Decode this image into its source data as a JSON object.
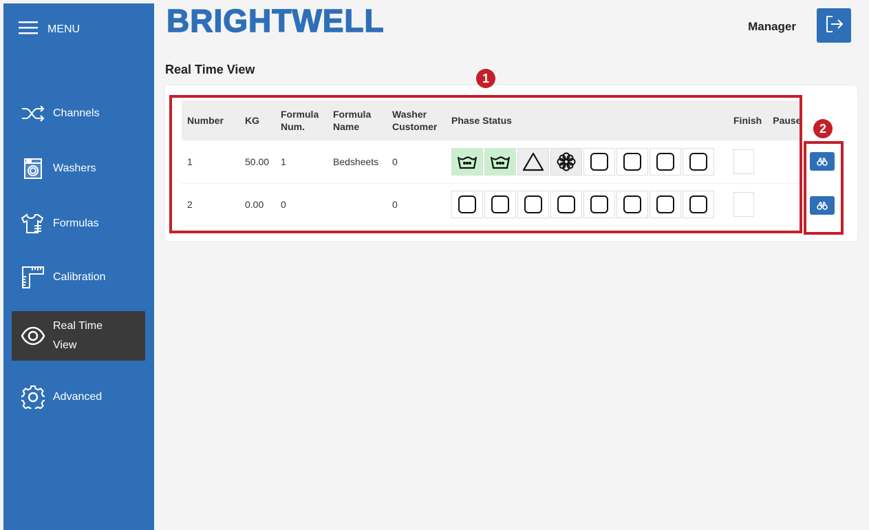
{
  "sidebar": {
    "menu_label": "MENU",
    "items": [
      {
        "label": "Channels",
        "icon": "shuffle-icon"
      },
      {
        "label": "Washers",
        "icon": "washer-icon"
      },
      {
        "label": "Formulas",
        "icon": "shirt-icon"
      },
      {
        "label": "Calibration",
        "icon": "ruler-icon"
      },
      {
        "label_line1": "Real Time",
        "label_line2": "View",
        "icon": "eye-icon",
        "active": true
      },
      {
        "label": "Advanced",
        "icon": "gear-icon"
      }
    ]
  },
  "header": {
    "logo": "BRIGHTWELL",
    "user": "Manager"
  },
  "page": {
    "title": "Real Time View"
  },
  "annotations": {
    "badge1": "1",
    "badge2": "2"
  },
  "table": {
    "headers": {
      "number": "Number",
      "kg": "KG",
      "formula_num_1": "Formula",
      "formula_num_2": "Num.",
      "formula_name_1": "Formula",
      "formula_name_2": "Name",
      "washer_customer_1": "Washer",
      "washer_customer_2": "Customer",
      "phase_status": "Phase Status",
      "finish": "Finish",
      "pause": "Pause"
    },
    "rows": [
      {
        "number": "1",
        "kg": "50.00",
        "formula_num": "1",
        "formula_name": "Bedsheets",
        "washer_customer": "0",
        "phases": [
          "wash-done",
          "wash-done",
          "bleach-current",
          "softener-current",
          "empty",
          "empty",
          "empty",
          "empty"
        ]
      },
      {
        "number": "2",
        "kg": "0.00",
        "formula_num": "0",
        "formula_name": "",
        "washer_customer": "0",
        "phases": [
          "empty",
          "empty",
          "empty",
          "empty",
          "empty",
          "empty",
          "empty",
          "empty"
        ]
      }
    ]
  },
  "colors": {
    "brand": "#2e6fb8",
    "highlight": "#c4202a",
    "phase_done": "#c9f0cd",
    "phase_current": "#ededed"
  }
}
